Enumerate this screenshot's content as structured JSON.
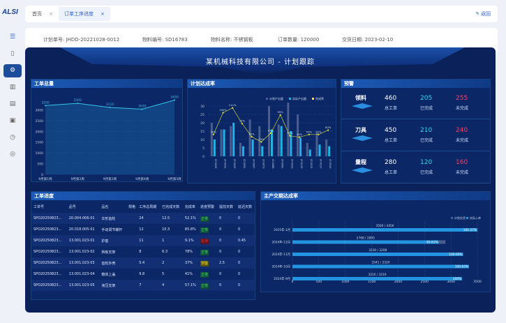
{
  "app": {
    "logo": "ALSI",
    "tabs": [
      {
        "label": "首页"
      },
      {
        "label": "订单工序进度"
      }
    ],
    "close": "×",
    "back": "返回"
  },
  "sidebar": {
    "items": [
      {
        "icon": "menu-icon"
      },
      {
        "icon": "document-icon"
      },
      {
        "icon": "settings-gear-icon",
        "active": true
      },
      {
        "icon": "building-icon"
      },
      {
        "icon": "calendar-icon"
      },
      {
        "icon": "calendar-check-icon"
      },
      {
        "icon": "clock-icon"
      },
      {
        "icon": "circle-settings-icon"
      }
    ]
  },
  "info": [
    {
      "label": "计划单号: JHDD-20221028-0012"
    },
    {
      "label": "物料编号: SD16783"
    },
    {
      "label": "物料名称: 不锈钢板"
    },
    {
      "label": "订单数量: 120000"
    },
    {
      "label": "交货日期: 2023-02-10"
    }
  ],
  "dashboard": {
    "title": "某机械科技有限公司 - 计划跟踪",
    "panel1": "工单总量",
    "panel2": "计划达成率",
    "panel3": "预警",
    "panel4": "工单进度",
    "panel5": "主产交期达成率"
  },
  "chart_data": [
    {
      "type": "area",
      "categories": [
        "9月第1周",
        "9月第2周",
        "9月第3周",
        "9月第4周",
        "9月第5周"
      ],
      "values": [
        3200,
        3302,
        3110,
        3030,
        3450
      ],
      "ylim": [
        0,
        3500
      ],
      "yticks": [
        0,
        500,
        1000,
        1500,
        2000,
        2500,
        3000
      ],
      "grid": true
    },
    {
      "type": "bar",
      "categories": [
        "LT-0026",
        "LT-0031",
        "LT-0045",
        "LT-0052",
        "LT-0067",
        "LT-0073",
        "LT-0088",
        "LT-0091",
        "LT-0103",
        "LT-0115",
        "LT-0122",
        "LT-0137",
        "LT-0140"
      ],
      "series": [
        {
          "name": "计划产出量",
          "values": [
            20,
            16,
            18,
            8,
            22,
            18,
            30,
            19,
            32,
            25,
            8,
            14,
            10
          ]
        },
        {
          "name": "实际产出量",
          "values": [
            10,
            16,
            20,
            6,
            10,
            6,
            16,
            18,
            15,
            11,
            4,
            7,
            6
          ]
        },
        {
          "name": "完成率",
          "values": [
            50,
            100,
            111,
            75,
            45,
            33,
            53,
            95,
            47,
            44,
            50,
            50,
            60
          ]
        }
      ],
      "ylim": [
        0,
        30
      ],
      "yticks": [
        0,
        5,
        10,
        15,
        20,
        25,
        30
      ],
      "legend": "top-right",
      "grid": true
    },
    {
      "type": "bar",
      "orientation": "horizontal",
      "categories": [
        "2025年-1月",
        "2024年-12月",
        "2024年-11月",
        "2024年-10月",
        "2024年-9月"
      ],
      "series": [
        {
          "name": "计划交货",
          "values": [
            3456,
            2895,
            3208,
            3320,
            3210
          ]
        },
        {
          "name": "实际入库",
          "values": [
            3500,
            2768,
            3230,
            3341,
            3210
          ]
        }
      ],
      "labels": [
        "3500 / 3456",
        "2768 / 2895",
        "3230 / 3208",
        "3341 / 3320",
        "3210 / 3210"
      ],
      "rates": [
        "101.27%",
        "95.61%",
        "100.69%",
        "100.63%",
        "100%"
      ],
      "xlim": [
        0,
        3500
      ],
      "xticks": [
        0,
        500,
        1000,
        1500,
        2000,
        2500,
        3000,
        3500
      ],
      "legend": "top-right",
      "grid": true
    }
  ],
  "warnings": [
    {
      "name": "领料",
      "total": "460",
      "done": "205",
      "undone": "255"
    },
    {
      "name": "刀具",
      "total": "450",
      "done": "210",
      "undone": "240"
    },
    {
      "name": "量程",
      "total": "280",
      "done": "120",
      "undone": "160"
    }
  ],
  "warning_labels": {
    "total": "总工单",
    "done": "已完成",
    "undone": "未完成"
  },
  "colors": {
    "done": "#2fd5f0",
    "undone": "#ff3f5e",
    "normal": "#3ddc6b",
    "delay": "#e03333",
    "warn": "#f2e035"
  },
  "table": {
    "headers": [
      "工单号",
      "品号",
      "品名",
      "规格",
      "工序总周期",
      "已完成天数",
      "完成率",
      "进度预警",
      "提前天数",
      "延迟天数"
    ],
    "rows": [
      [
        "SPO20250823...",
        "20.004.006-01",
        "伞形齿轮",
        "",
        "24",
        "12.5",
        "52.1%",
        "正常",
        "0",
        "0"
      ],
      [
        "SPO20250823...",
        "20.018.005-01",
        "手动调节螺杆",
        "",
        "12",
        "10.3",
        "85.8%",
        "正常",
        "0",
        "0"
      ],
      [
        "SPO20250823...",
        "13.001.023-01",
        "护套",
        "",
        "11",
        "1",
        "9.1%",
        "延误",
        "0",
        "0.45"
      ],
      [
        "SPO20250823...",
        "13.001.023-02",
        "挡板支架",
        "",
        "8",
        "6.3",
        "78%",
        "正常",
        "0",
        "0"
      ],
      [
        "SPO20250823...",
        "13.001.023-03",
        "齿轮外壳",
        "",
        "5.4",
        "2",
        "37%",
        "预警",
        "2.5",
        "0"
      ],
      [
        "SPO20250823...",
        "13.001.023-04",
        "箱体上盖",
        "",
        "9.8",
        "5",
        "41%",
        "正常",
        "0",
        "0"
      ],
      [
        "SPO20250823...",
        "13.001.023-05",
        "液压支架",
        "",
        "7",
        "4",
        "57.1%",
        "正常",
        "0",
        "0"
      ]
    ]
  }
}
